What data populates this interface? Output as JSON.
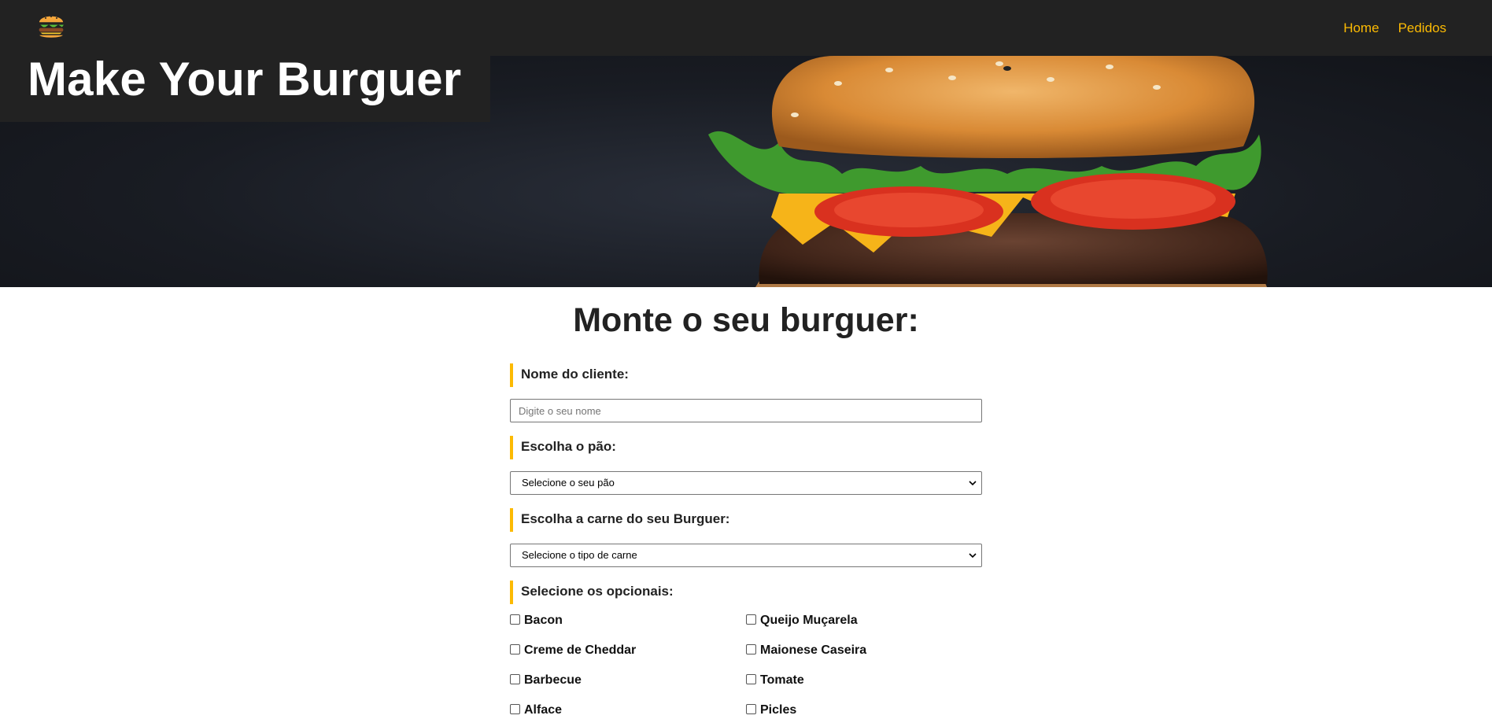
{
  "nav": {
    "logo": "burger-logo",
    "links": [
      "Home",
      "Pedidos"
    ],
    "link_color": "#fcba03",
    "background": "#222222"
  },
  "hero": {
    "title": "Make Your Burguer"
  },
  "form": {
    "title": "Monte o seu burguer:",
    "name_label": "Nome do cliente:",
    "name_placeholder": "Digite o seu nome",
    "bread_label": "Escolha o pão:",
    "bread_selected": "Selecione o seu pão",
    "meat_label": "Escolha a carne do seu Burguer:",
    "meat_selected": "Selecione o tipo de carne",
    "optionals_label": "Selecione os opcionais:",
    "optionals": [
      "Bacon",
      "Queijo Muçarela",
      "Creme de Cheddar",
      "Maionese Caseira",
      "Barbecue",
      "Tomate",
      "Alface",
      "Picles"
    ],
    "accent_color": "#fcba03"
  }
}
